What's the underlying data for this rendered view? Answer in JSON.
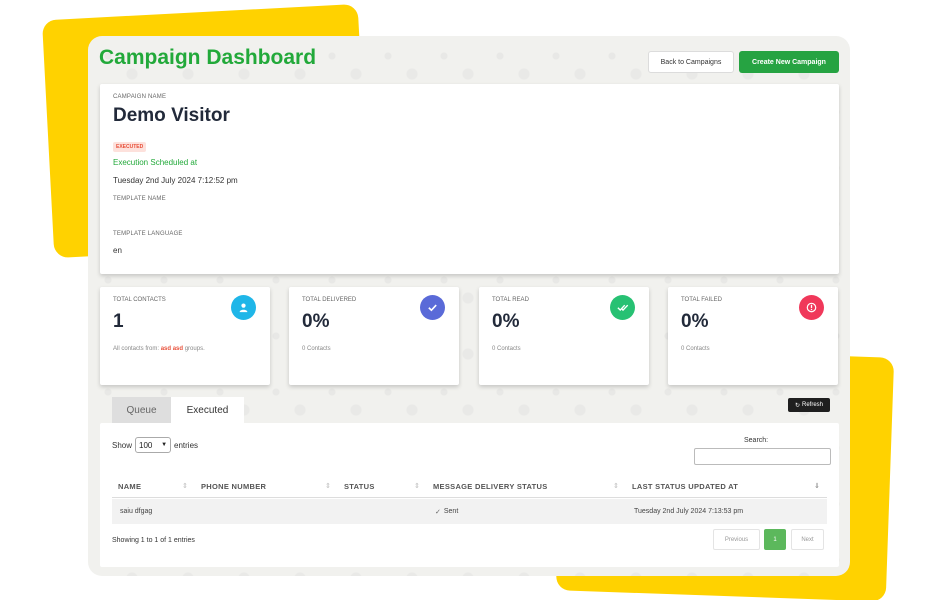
{
  "header": {
    "title": "Campaign Dashboard",
    "back_label": "Back to Campaigns",
    "create_label": "Create New Campaign"
  },
  "campaign": {
    "name_label": "CAMPAIGN NAME",
    "name": "Demo Visitor",
    "status_badge": "EXECUTED",
    "scheduled_label": "Execution Scheduled at",
    "scheduled_at": "Tuesday 2nd July 2024 7:12:52 pm",
    "template_name_label": "TEMPLATE NAME",
    "template_name": "",
    "template_language_label": "TEMPLATE LANGUAGE",
    "template_language": "en"
  },
  "stats": [
    {
      "label": "TOTAL CONTACTS",
      "value": "1",
      "foot_prefix": "All contacts from:",
      "foot_group": "asd asd",
      "foot_suffix": "groups.",
      "icon": "user-icon",
      "color": "#1fb6e8"
    },
    {
      "label": "TOTAL DELIVERED",
      "value": "0%",
      "foot": "0 Contacts",
      "icon": "check-icon",
      "color": "#5a6ad8"
    },
    {
      "label": "TOTAL READ",
      "value": "0%",
      "foot": "0 Contacts",
      "icon": "double-check-icon",
      "color": "#27c173"
    },
    {
      "label": "TOTAL FAILED",
      "value": "0%",
      "foot": "0 Contacts",
      "icon": "alert-icon",
      "color": "#f0385a"
    }
  ],
  "tabs": [
    {
      "label": "Queue",
      "active": false
    },
    {
      "label": "Executed",
      "active": true
    }
  ],
  "refresh_label": "Refresh",
  "table": {
    "show_label": "Show",
    "page_size": "100",
    "entries_label": "entries",
    "search_label": "Search:",
    "search_value": "",
    "columns": [
      "NAME",
      "PHONE NUMBER",
      "STATUS",
      "MESSAGE DELIVERY STATUS",
      "LAST STATUS UPDATED AT"
    ],
    "rows": [
      {
        "name": "saiu dfgag",
        "phone": "",
        "status": "",
        "delivery_status": "Sent",
        "updated_at": "Tuesday 2nd July 2024 7:13:53 pm"
      }
    ],
    "info": "Showing 1 to 1 of 1 entries",
    "pagination": {
      "previous": "Previous",
      "current": "1",
      "next": "Next"
    }
  }
}
